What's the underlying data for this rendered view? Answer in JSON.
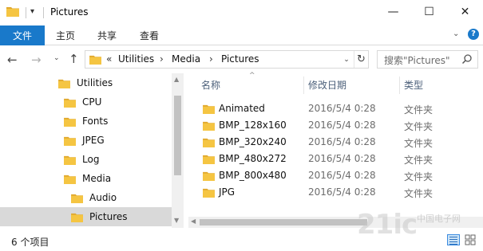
{
  "window": {
    "title": "Pictures",
    "pin_glyph": "▾",
    "minimize_glyph": "—",
    "maximize_glyph": "☐",
    "close_glyph": "✕"
  },
  "ribbon": {
    "file_tab": "文件",
    "tabs": [
      "主页",
      "共享",
      "查看"
    ],
    "expand_glyph": "⌄",
    "help_glyph": "?",
    "accent_color": "#1979ca"
  },
  "nav": {
    "back_glyph": "←",
    "forward_glyph": "→",
    "recent_glyph": "⌄",
    "up_glyph": "↑",
    "breadcrumb_prefix": "«",
    "breadcrumb": [
      "Utilities",
      "Media",
      "Pictures"
    ],
    "separator_glyph": "›",
    "dropdown_glyph": "⌄",
    "refresh_glyph": "↻",
    "search_placeholder": "搜索\"Pictures\""
  },
  "tree": {
    "items": [
      {
        "label": "Utilities",
        "level": 0,
        "selected": false
      },
      {
        "label": "CPU",
        "level": 1,
        "selected": false
      },
      {
        "label": "Fonts",
        "level": 1,
        "selected": false
      },
      {
        "label": "JPEG",
        "level": 1,
        "selected": false
      },
      {
        "label": "Log",
        "level": 1,
        "selected": false
      },
      {
        "label": "Media",
        "level": 1,
        "selected": false
      },
      {
        "label": "Audio",
        "level": 2,
        "selected": false
      },
      {
        "label": "Pictures",
        "level": 2,
        "selected": true
      }
    ]
  },
  "list": {
    "columns": {
      "name": "名称",
      "date": "修改日期",
      "type": "类型"
    },
    "sort_glyph": "^",
    "rows": [
      {
        "name": "Animated",
        "date": "2016/5/4 0:28",
        "type": "文件夹"
      },
      {
        "name": "BMP_128x160",
        "date": "2016/5/4 0:28",
        "type": "文件夹"
      },
      {
        "name": "BMP_320x240",
        "date": "2016/5/4 0:28",
        "type": "文件夹"
      },
      {
        "name": "BMP_480x272",
        "date": "2016/5/4 0:28",
        "type": "文件夹"
      },
      {
        "name": "BMP_800x480",
        "date": "2016/5/4 0:28",
        "type": "文件夹"
      },
      {
        "name": "JPG",
        "date": "2016/5/4 0:28",
        "type": "文件夹"
      }
    ]
  },
  "status": {
    "item_count": "6 个项目"
  },
  "watermark": {
    "text": "21ic",
    "sub": "中国电子网"
  },
  "colors": {
    "folder": "#f5c542",
    "folder_dark": "#e0a82e",
    "selected_bg": "#d9d9d9",
    "header_text": "#4c607a"
  }
}
